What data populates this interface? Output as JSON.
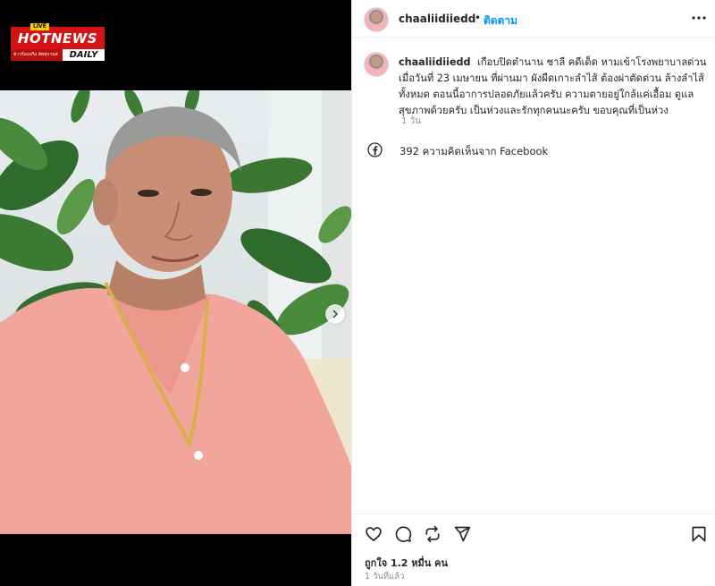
{
  "logo": {
    "badge": "LIVE",
    "main": "HOTNEWS",
    "sub": "ข่าวร้อนจริง อัพทุกวนส",
    "daily": "DAILY"
  },
  "post": {
    "username": "chaaliidiiedd",
    "follow_label": "ติดตาม",
    "separator": "•",
    "caption": "เกือบปิดตำนาน ชาลี คดีเด็ด หามเข้าโรงพยาบาลด่วน เมื่อวันที่ 23 เมษายน ที่ผ่านมา ผังผืดเกาะลำไส้ ต้องผ่าตัดด่วน ล้างลำไส้ทั้งหมด ตอนนี้อาการปลอดภัยแล้วครับ ความตายอยู่ใกล้แค่เอื้อม ดูแลสุขภาพด้วยครับ เป็นห่วงและรักทุกคนนะครับ ขอบคุณที่เป็นห่วง",
    "caption_time": "1 วัน",
    "facebook_comments": "392 ความคิดเห็นจาก Facebook",
    "likes": "ถูกใจ 1.2 หมื่น คน",
    "posted_ago": "1 วันที่แล้ว"
  },
  "icons": {
    "more": "more-horizontal-icon",
    "like": "heart-icon",
    "comment": "comment-icon",
    "repost": "repost-icon",
    "share": "send-icon",
    "save": "bookmark-icon",
    "facebook": "facebook-icon",
    "carousel_next": "chevron-right-icon"
  },
  "colors": {
    "accent": "#0095f6",
    "logo_red": "#d41414",
    "secondary_text": "#8e8e8e"
  }
}
